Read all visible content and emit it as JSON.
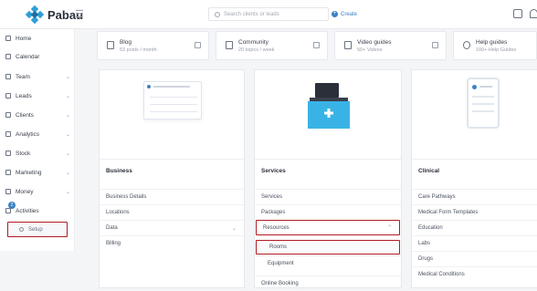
{
  "app": {
    "brand": "Pabau"
  },
  "topbar": {
    "search_placeholder": "Search clients or leads",
    "create_label": "Create"
  },
  "sidebar": {
    "items": [
      {
        "label": "Home",
        "icon": "home-icon",
        "chevron": ""
      },
      {
        "label": "Calendar",
        "icon": "calendar-icon",
        "chevron": ""
      },
      {
        "label": "Team",
        "icon": "team-icon",
        "chevron": "⌄"
      },
      {
        "label": "Leads",
        "icon": "leads-icon",
        "chevron": "⌄"
      },
      {
        "label": "Clients",
        "icon": "clients-icon",
        "chevron": "⌄"
      },
      {
        "label": "Analytics",
        "icon": "analytics-icon",
        "chevron": "⌄"
      },
      {
        "label": "Stock",
        "icon": "stock-icon",
        "chevron": "⌄"
      },
      {
        "label": "Marketing",
        "icon": "marketing-icon",
        "chevron": "⌄"
      },
      {
        "label": "Money",
        "icon": "money-icon",
        "chevron": "⌄"
      },
      {
        "label": "Activities",
        "icon": "activities-icon",
        "chevron": ""
      }
    ],
    "activities_badge": "2",
    "setup_label": "Setup"
  },
  "cards": [
    {
      "title": "Blog",
      "subtitle": "53 posts / month",
      "icon": "pen-icon"
    },
    {
      "title": "Community",
      "subtitle": "20 topics / week",
      "icon": "chat-icon"
    },
    {
      "title": "Video guides",
      "subtitle": "50+ Videos",
      "icon": "play-icon"
    },
    {
      "title": "Help guides",
      "subtitle": "100+ Help Guides",
      "icon": "help-icon"
    }
  ],
  "columns": {
    "business": {
      "title": "Business",
      "rows": [
        "Business Details",
        "Locations",
        "Data",
        "Billing"
      ],
      "data_chevron": "⌄"
    },
    "services": {
      "title": "Services",
      "rows": [
        "Services",
        "Packages",
        "Resources",
        "Rooms",
        "Equipment",
        "Online Booking"
      ],
      "resources_chevron": "⌃"
    },
    "clinical": {
      "title": "Clinical",
      "rows": [
        "Care Pathways",
        "Medical Form Templates",
        "Education",
        "Labs",
        "Drugs",
        "Medical Conditions"
      ]
    }
  },
  "colors": {
    "accent": "#3b82c4",
    "highlight": "#b01c22",
    "brand": "#2f9fd8"
  }
}
